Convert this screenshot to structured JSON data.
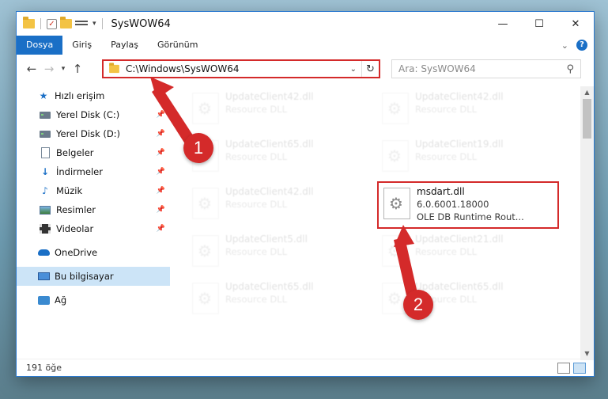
{
  "window": {
    "title": "SysWOW64",
    "minimize": "—",
    "maximize": "☐",
    "close": "✕"
  },
  "ribbon": {
    "tabs": [
      "Dosya",
      "Giriş",
      "Paylaş",
      "Görünüm"
    ],
    "help": "?"
  },
  "nav": {
    "address": "C:\\Windows\\SysWOW64",
    "search_placeholder": "Ara: SysWOW64"
  },
  "sidebar": {
    "items": [
      {
        "label": "Hızlı erişim",
        "icon": "star-icon"
      },
      {
        "label": "Yerel Disk (C:)",
        "icon": "drive-icon",
        "pinned": true
      },
      {
        "label": "Yerel Disk (D:)",
        "icon": "drive-icon",
        "pinned": true
      },
      {
        "label": "Belgeler",
        "icon": "documents-icon",
        "pinned": true
      },
      {
        "label": "İndirmeler",
        "icon": "download-icon",
        "pinned": true
      },
      {
        "label": "Müzik",
        "icon": "music-icon",
        "pinned": true
      },
      {
        "label": "Resimler",
        "icon": "pictures-icon",
        "pinned": true
      },
      {
        "label": "Videolar",
        "icon": "videos-icon",
        "pinned": true
      },
      {
        "label": "OneDrive",
        "icon": "onedrive-icon"
      },
      {
        "label": "Bu bilgisayar",
        "icon": "computer-icon",
        "selected": true
      },
      {
        "label": "Ağ",
        "icon": "network-icon"
      }
    ]
  },
  "files": [
    {
      "name": "UpdateClient42.dll",
      "desc": "Resource DLL"
    },
    {
      "name": "UpdateClient42.dll",
      "desc": "Resource DLL"
    },
    {
      "name": "UpdateClient65.dll",
      "desc": "Resource DLL"
    },
    {
      "name": "UpdateClient19.dll",
      "desc": "Resource DLL"
    },
    {
      "name": "UpdateClient42.dll",
      "desc": "Resource DLL"
    },
    {
      "name": "UpdateClient5.dll",
      "desc": "Resource DLL"
    },
    {
      "name": "UpdateClient21.dll",
      "desc": "Resource DLL"
    },
    {
      "name": "UpdateClient65.dll",
      "desc": "Resource DLL"
    },
    {
      "name": "UpdateClient65.dll",
      "desc": "Resource DLL"
    }
  ],
  "highlighted_file": {
    "name": "msdart.dll",
    "version": "6.0.6001.18000",
    "desc": "OLE DB Runtime Rout..."
  },
  "status": {
    "count": "191 öğe"
  },
  "annotations": {
    "step1": "1",
    "step2": "2",
    "color": "#d42a2a"
  }
}
